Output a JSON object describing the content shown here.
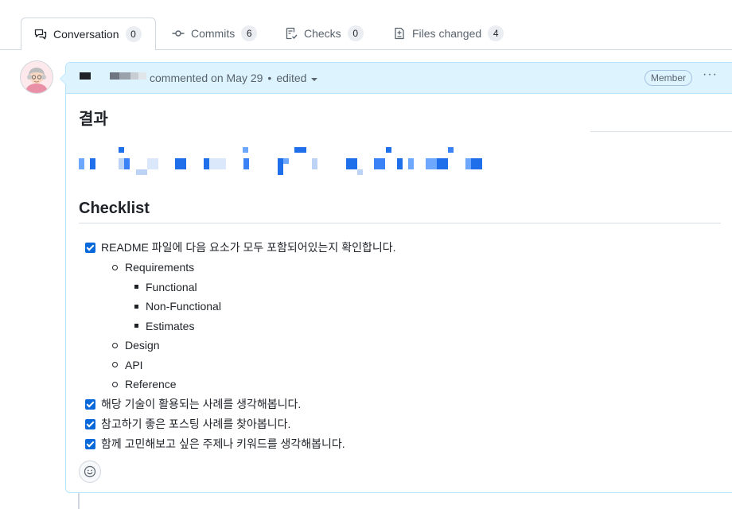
{
  "tabs": [
    {
      "label": "Conversation",
      "count": "0",
      "icon": "comment-discussion-icon"
    },
    {
      "label": "Commits",
      "count": "6",
      "icon": "git-commit-icon"
    },
    {
      "label": "Checks",
      "count": "0",
      "icon": "checklist-icon"
    },
    {
      "label": "Files changed",
      "count": "4",
      "icon": "file-diff-icon"
    }
  ],
  "comment": {
    "meta": "commented on May 29",
    "separator": "•",
    "edited": "edited",
    "badge": "Member",
    "more": "···",
    "heading_result": "결과",
    "heading_checklist": "Checklist",
    "tasks": [
      {
        "label": "README 파일에 다음 요소가 모두 포함되어있는지 확인합니다.",
        "checked": true
      },
      {
        "label": "해당 기술이 활용되는 사례를 생각해봅니다.",
        "checked": true
      },
      {
        "label": "참고하기 좋은 포스팅 사례를 찾아봅니다.",
        "checked": true
      },
      {
        "label": "함께 고민해보고 싶은 주제나 키워드를 생각해봅니다.",
        "checked": true
      }
    ],
    "sub_items": {
      "requirements": "Requirements",
      "functional": "Functional",
      "non_functional": "Non-Functional",
      "estimates": "Estimates",
      "design": "Design",
      "api": "API",
      "reference": "Reference"
    }
  },
  "colors": {
    "header_bg": "#ddf4ff",
    "border": "#b6e3ff",
    "accent": "#0969da"
  }
}
